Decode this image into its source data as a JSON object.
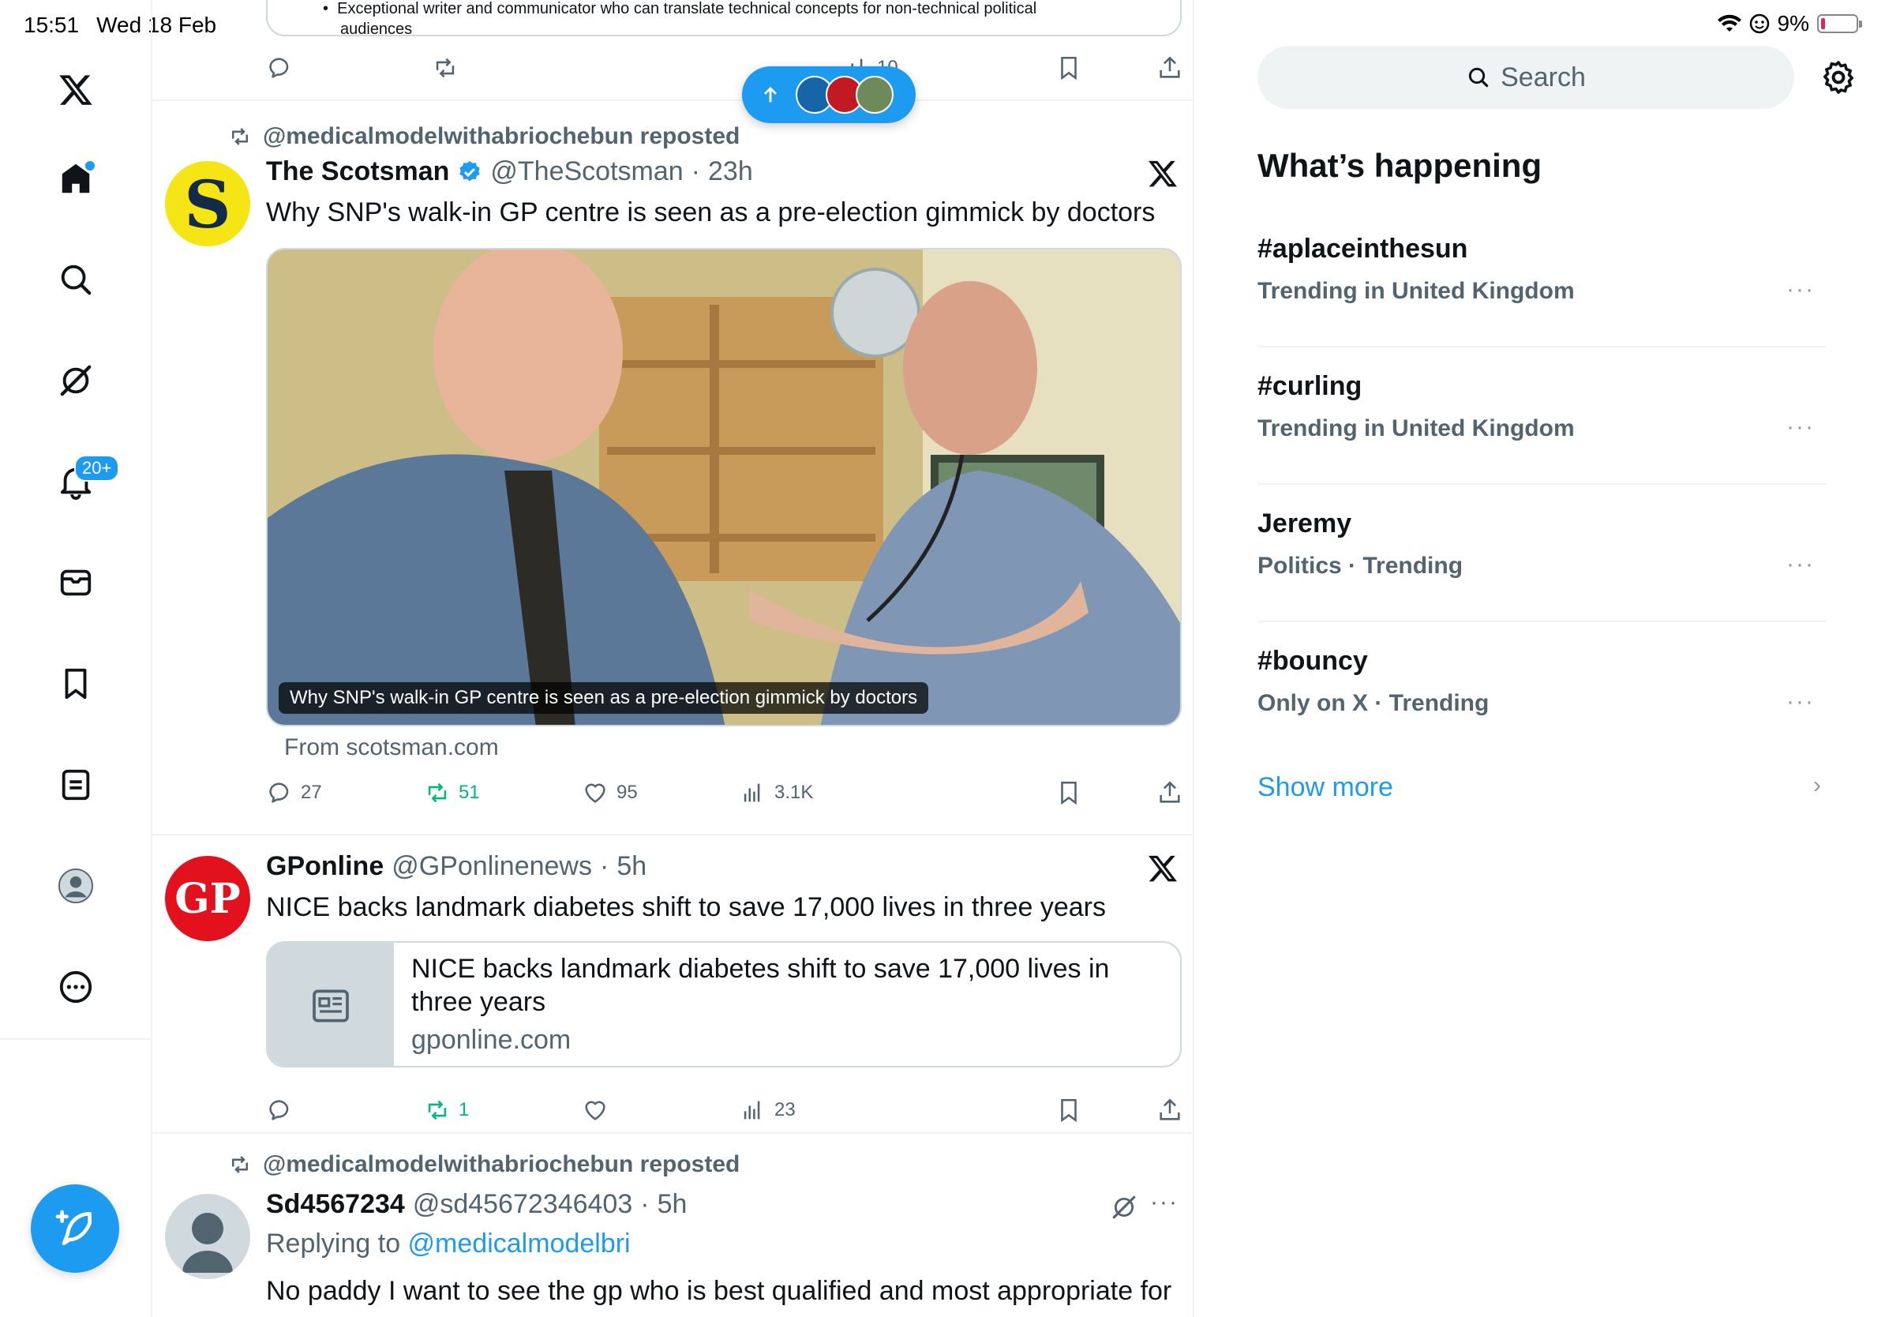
{
  "status": {
    "time": "15:51",
    "date": "Wed 18 Feb",
    "battery": "9%"
  },
  "nav": {
    "notifications_badge": "20+"
  },
  "feed": {
    "top_partial": {
      "bullet_line1": "Exceptional writer and communicator who can translate technical concepts for non-technical political",
      "bullet_line2": "audiences",
      "views": "10"
    },
    "new_posts_pill": {
      "avatars": [
        "theb",
        "red-avatar",
        "green-avatar"
      ]
    },
    "tweets": [
      {
        "repost_by": "@medicalmodelwithabriochebun reposted",
        "name": "The Scotsman",
        "verified": true,
        "handle": "@TheScotsman",
        "dot": "·",
        "time": "23h",
        "text": "Why SNP's walk-in GP centre is seen as a pre-election gimmick by doctors",
        "media_caption": "Why SNP's walk-in GP centre is seen as a pre-election gimmick by doctors",
        "from": "From scotsman.com",
        "replies": "27",
        "reposts": "51",
        "likes": "95",
        "views": "3.1K"
      },
      {
        "name": "GPonline",
        "handle": "@GPonlinenews",
        "dot": "·",
        "time": "5h",
        "text": "NICE backs landmark diabetes shift to save 17,000 lives in three years",
        "card_title": "NICE backs landmark diabetes shift to save 17,000 lives in three years",
        "card_domain": "gponline.com",
        "replies": "",
        "reposts": "1",
        "likes": "",
        "views": "23"
      },
      {
        "repost_by": "@medicalmodelwithabriochebun reposted",
        "name": "Sd4567234",
        "handle": "@sd45672346403",
        "dot": "·",
        "time": "5h",
        "replying_prefix": "Replying to ",
        "replying_to": "@medicalmodelbri",
        "text": "No paddy I want to see the gp who is best qualified and most appropriate for"
      }
    ]
  },
  "sidebar": {
    "search_placeholder": "Search",
    "title": "What’s happening",
    "trends": [
      {
        "name": "#aplaceinthesun",
        "meta": "Trending in United Kingdom"
      },
      {
        "name": "#curling",
        "meta": "Trending in United Kingdom"
      },
      {
        "name": "Jeremy",
        "meta": "Politics · Trending"
      },
      {
        "name": "#bouncy",
        "meta": "Only on X · Trending"
      }
    ],
    "more_glyph": "···",
    "show_more": "Show more"
  },
  "colors": {
    "accent": "#1d9bf0",
    "repost_green": "#00ba7c",
    "muted": "#536471",
    "border": "#eff3f4"
  }
}
